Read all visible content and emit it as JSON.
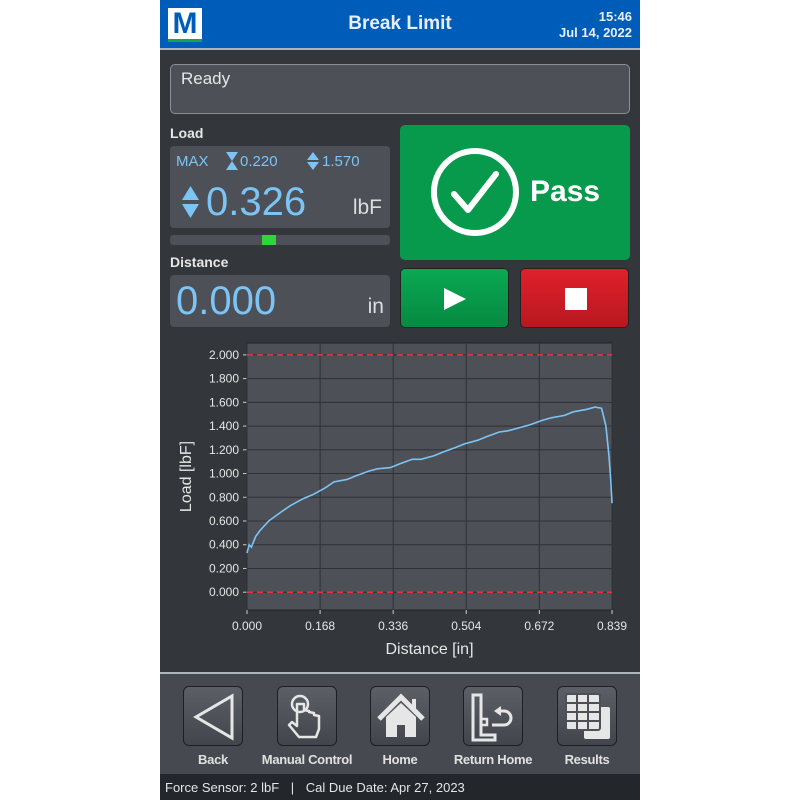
{
  "header": {
    "title": "Break Limit",
    "time": "15:46",
    "date": "Jul 14, 2022",
    "logo": "M"
  },
  "status": "Ready",
  "load": {
    "label": "Load",
    "max_label": "MAX",
    "min_value": "0.220",
    "max_value": "1.570",
    "value": "0.326",
    "unit": "lbF",
    "bar_position_percent": 45
  },
  "distance": {
    "label": "Distance",
    "value": "0.000",
    "unit": "in"
  },
  "result": {
    "label": "Pass",
    "icon": "check-circle-icon",
    "color": "#079a4c"
  },
  "controls": {
    "start_icon": "play-icon",
    "stop_icon": "stop-icon"
  },
  "chart_data": {
    "type": "line",
    "xlabel": "Distance [in]",
    "ylabel": "Load [lbF]",
    "xlim": [
      0,
      0.839
    ],
    "ylim": [
      -0.15,
      2.1
    ],
    "xticks": [
      "0.000",
      "0.168",
      "0.336",
      "0.504",
      "0.672",
      "0.839"
    ],
    "yticks": [
      "0.000",
      "0.200",
      "0.400",
      "0.600",
      "0.800",
      "1.000",
      "1.200",
      "1.400",
      "1.600",
      "1.800",
      "2.000"
    ],
    "limit_lines": [
      2.0,
      0.0
    ],
    "grid": true,
    "series": [
      {
        "color": "#7cc4f5",
        "x": [
          0,
          0.005,
          0.01,
          0.02,
          0.03,
          0.05,
          0.08,
          0.1,
          0.13,
          0.15,
          0.18,
          0.2,
          0.23,
          0.25,
          0.28,
          0.3,
          0.33,
          0.35,
          0.38,
          0.4,
          0.43,
          0.45,
          0.48,
          0.5,
          0.53,
          0.55,
          0.58,
          0.6,
          0.63,
          0.65,
          0.68,
          0.7,
          0.73,
          0.75,
          0.78,
          0.8,
          0.815,
          0.825,
          0.832,
          0.836,
          0.839
        ],
        "y": [
          0.33,
          0.4,
          0.38,
          0.47,
          0.52,
          0.6,
          0.68,
          0.73,
          0.79,
          0.82,
          0.88,
          0.93,
          0.95,
          0.98,
          1.02,
          1.04,
          1.05,
          1.08,
          1.12,
          1.12,
          1.15,
          1.18,
          1.22,
          1.25,
          1.28,
          1.31,
          1.35,
          1.36,
          1.39,
          1.41,
          1.45,
          1.47,
          1.49,
          1.52,
          1.54,
          1.56,
          1.55,
          1.4,
          1.15,
          0.95,
          0.75
        ]
      }
    ]
  },
  "nav": [
    {
      "label": "Back",
      "icon": "back-triangle-icon"
    },
    {
      "label": "Manual Control",
      "icon": "hand-pointer-icon"
    },
    {
      "label": "Home",
      "icon": "home-icon"
    },
    {
      "label": "Return Home",
      "icon": "return-home-icon"
    },
    {
      "label": "Results",
      "icon": "table-icon"
    }
  ],
  "footer": {
    "sensor": "Force Sensor: 2 lbF",
    "separator": "|",
    "cal": "Cal Due Date: Apr 27, 2023"
  }
}
